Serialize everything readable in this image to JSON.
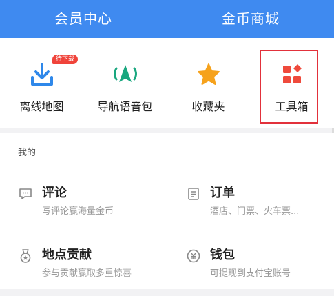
{
  "header": {
    "tabs": [
      {
        "label": "会员中心"
      },
      {
        "label": "金币商城"
      }
    ]
  },
  "tools": [
    {
      "label": "离线地图",
      "icon": "download-icon",
      "badge": "待下载",
      "color": "#2f88ea"
    },
    {
      "label": "导航语音包",
      "icon": "navigation-voice-icon",
      "color": "#19a77f"
    },
    {
      "label": "收藏夹",
      "icon": "star-icon",
      "color": "#f6a21c"
    },
    {
      "label": "工具箱",
      "icon": "toolbox-icon",
      "color": "#ef4a3c"
    }
  ],
  "mine": {
    "heading": "我的",
    "items": [
      {
        "title": "评论",
        "subtitle": "写评论赢海量金币",
        "icon": "comment-icon"
      },
      {
        "title": "订单",
        "subtitle": "酒店、门票、火车票...",
        "icon": "order-icon"
      },
      {
        "title": "地点贡献",
        "subtitle": "参与贡献赢取多重惊喜",
        "icon": "medal-icon"
      },
      {
        "title": "钱包",
        "subtitle": "可提现到支付宝账号",
        "icon": "wallet-icon"
      }
    ]
  },
  "colors": {
    "header_bg": "#3f8af0",
    "highlight": "#e2313b",
    "badge": "#f0433a"
  }
}
